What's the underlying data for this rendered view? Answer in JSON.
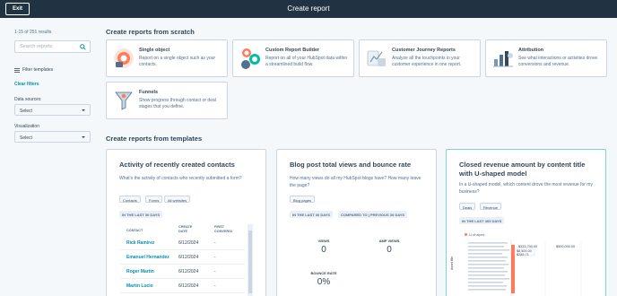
{
  "header": {
    "exit_label": "Exit",
    "title": "Create report"
  },
  "sidebar": {
    "results_count": "1-15 of 251 results",
    "search_placeholder": "Search reports",
    "filter_title": "Filter templates",
    "clear_filters": "Clear filters",
    "data_sources_label": "Data sources",
    "data_sources_value": "Select",
    "visualization_label": "Visualization",
    "visualization_value": "Select"
  },
  "scratch": {
    "heading": "Create reports from scratch",
    "cards": [
      {
        "title": "Single object",
        "desc": "Report on a single object such as your contacts.",
        "icon": "single-object-illustration"
      },
      {
        "title": "Custom Report Builder",
        "desc": "Report on all of your HubSpot data within a streamlined build flow.",
        "icon": "custom-report-builder-illustration"
      },
      {
        "title": "Customer Journey Reports",
        "desc": "Analyze all the touchpoints in your customer experience in one report.",
        "icon": "customer-journey-illustration"
      },
      {
        "title": "Attribution",
        "desc": "See what interactions or activities drove conversions and revenue.",
        "icon": "attribution-illustration"
      },
      {
        "title": "Funnels",
        "desc": "Show progress through contact or deal stages that you define.",
        "icon": "funnels-illustration"
      }
    ]
  },
  "templates": {
    "heading": "Create reports from templates",
    "cards": [
      {
        "title": "Activity of recently created contacts",
        "desc": "What's the activity of contacts who recently submitted a form?",
        "tags": [
          "Contacts",
          "Forms",
          "All websites"
        ],
        "badges": [
          "IN THE LAST 30 DAYS"
        ],
        "table": {
          "headers": [
            "CONTACT",
            "CREATE DATE",
            "FIRST CONVERSI"
          ],
          "rows": [
            {
              "name": "Rick Ramirez",
              "date": "6/12/2024",
              "conv": "-"
            },
            {
              "name": "Emanuel Hernandez",
              "date": "6/12/2024",
              "conv": "-"
            },
            {
              "name": "Roger Martin",
              "date": "6/12/2024",
              "conv": "-"
            },
            {
              "name": "Martin Lucio",
              "date": "6/12/2024",
              "conv": "-"
            }
          ]
        }
      },
      {
        "title": "Blog post total views and bounce rate",
        "desc": "How many views do all my HubSpot blogs have? How many leave the page?",
        "tags": [
          "Blog pages"
        ],
        "badges": [
          "IN THE LAST 30 DAYS",
          "COMPARED TO | PREVIOUS 30 DAYS"
        ],
        "metrics": [
          {
            "label": "VIEWS",
            "value": "0"
          },
          {
            "label": "AMP VIEWS",
            "value": "0"
          },
          {
            "label": "BOUNCE RATE",
            "value": "0%"
          }
        ]
      },
      {
        "title": "Closed revenue amount by content title with U-shaped model",
        "desc": "In a U-shaped model, which content drove the most revenue for my business?",
        "tags": [
          "Deals",
          "Revenue"
        ],
        "badges": [
          "IN THE LAST 365 DAYS"
        ],
        "legend": "U-shaped",
        "y_axis_label": "Asset title",
        "bar_labels": [
          "$333,750.00",
          "$900,000.00",
          "$8,500.00",
          "$285.71"
        ]
      }
    ]
  }
}
